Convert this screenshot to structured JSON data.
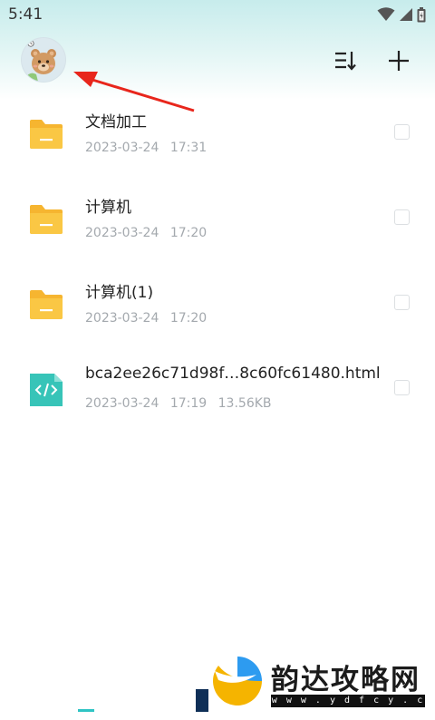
{
  "status_bar": {
    "time": "5:41"
  },
  "toolbar": {
    "sort_icon": "sort-icon",
    "add_icon": "plus-icon"
  },
  "files": [
    {
      "name": "文档加工",
      "date": "2023-03-24",
      "time": "17:31",
      "size": "",
      "type": "folder"
    },
    {
      "name": "计算机",
      "date": "2023-03-24",
      "time": "17:20",
      "size": "",
      "type": "folder"
    },
    {
      "name": "计算机(1)",
      "date": "2023-03-24",
      "time": "17:20",
      "size": "",
      "type": "folder"
    },
    {
      "name": "bca2ee26c71d98f…8c60fc61480.html",
      "date": "2023-03-24",
      "time": "17:19",
      "size": "13.56KB",
      "type": "html"
    }
  ],
  "watermark": {
    "title": "韵达攻略网",
    "url": "w w w . y d f c y . c o m"
  },
  "colors": {
    "accent": "#2fc4c4",
    "folder": "#f9c03a",
    "html_icon": "#37c4b8",
    "annotation": "#e8261c"
  }
}
